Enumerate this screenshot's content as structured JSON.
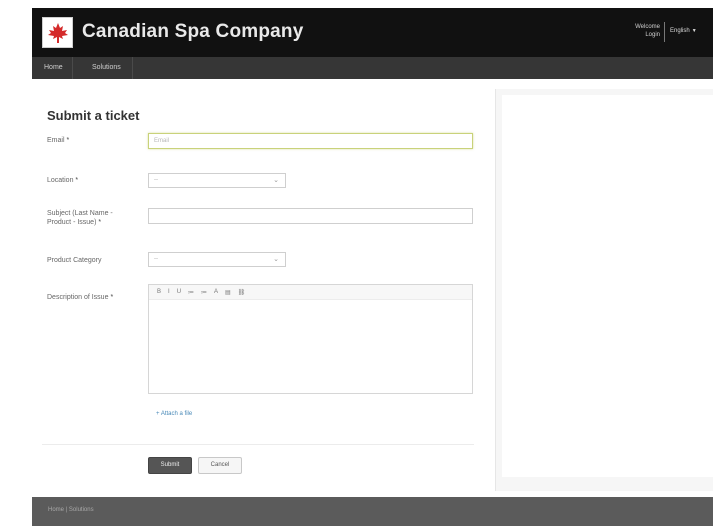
{
  "header": {
    "brand": "Canadian Spa Company",
    "welcome": "Welcome",
    "login": "Login",
    "language": "English"
  },
  "nav": {
    "items": [
      {
        "label": "Home"
      },
      {
        "label": "Solutions"
      }
    ]
  },
  "form": {
    "title": "Submit a ticket",
    "email": {
      "label": "Email",
      "placeholder": "Email"
    },
    "location": {
      "label": "Location",
      "value": "--"
    },
    "subject": {
      "label_line1": "Subject (Last Name -",
      "label_line2": "Product - Issue)",
      "value": ""
    },
    "product_category": {
      "label": "Product Category",
      "value": "--"
    },
    "description": {
      "label": "Description of Issue"
    },
    "required_marker": "*",
    "toolbar": [
      "B",
      "I",
      "U",
      "≔",
      "≔",
      "A",
      "▤",
      "⛓"
    ],
    "attach_label": "+ Attach a file",
    "submit_label": "Submit",
    "cancel_label": "Cancel"
  },
  "footer": {
    "links": "Home | Solutions"
  },
  "colors": {
    "header_bg": "#111111",
    "nav_bg": "#363636",
    "footer_bg": "#5b5b5b",
    "focus_border": "#c9d27a",
    "link": "#4a8ab8",
    "maple_red": "#d42a2a"
  }
}
